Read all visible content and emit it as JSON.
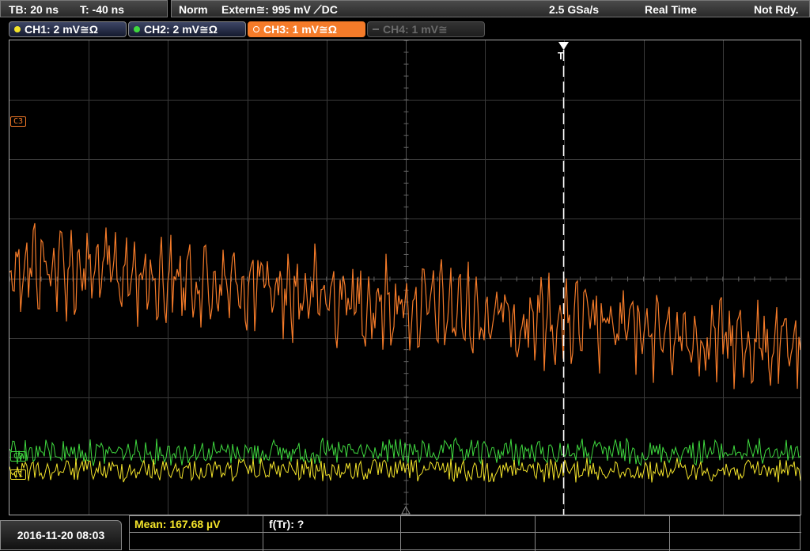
{
  "header": {
    "timebase": "TB: 20 ns",
    "trigger_time": "T: -40 ns",
    "acq_mode": "Norm",
    "trigger_source": "Extern≅: 995 mV ⟋DC",
    "sample_rate": "2.5 GSa/s",
    "display_mode": "Real Time",
    "status": "Not Rdy."
  },
  "channels": [
    {
      "label": "CH1: 2 mV≅Ω",
      "color": "#f4e42a",
      "state": "on"
    },
    {
      "label": "CH2: 2 mV≅Ω",
      "color": "#3fd93f",
      "state": "on"
    },
    {
      "label": "CH3: 1 mV≅Ω",
      "color": "#f57b29",
      "state": "active"
    },
    {
      "label": "CH4: 1 mV≅",
      "color": "#6a6a6a",
      "state": "off"
    }
  ],
  "markers": {
    "ch3": "C3",
    "ch2": "C2",
    "ch1": "C1",
    "trigger": "T"
  },
  "footer": {
    "datetime": "2016-11-20 08:03",
    "mean_label": "Mean: 167.68 µV",
    "freq_label": "f(Tr): ?"
  },
  "colors": {
    "ch1": "#f4e42a",
    "ch2": "#3fd93f",
    "ch3": "#f57b29",
    "grid": "#3a3a3a",
    "background": "#000000"
  }
}
